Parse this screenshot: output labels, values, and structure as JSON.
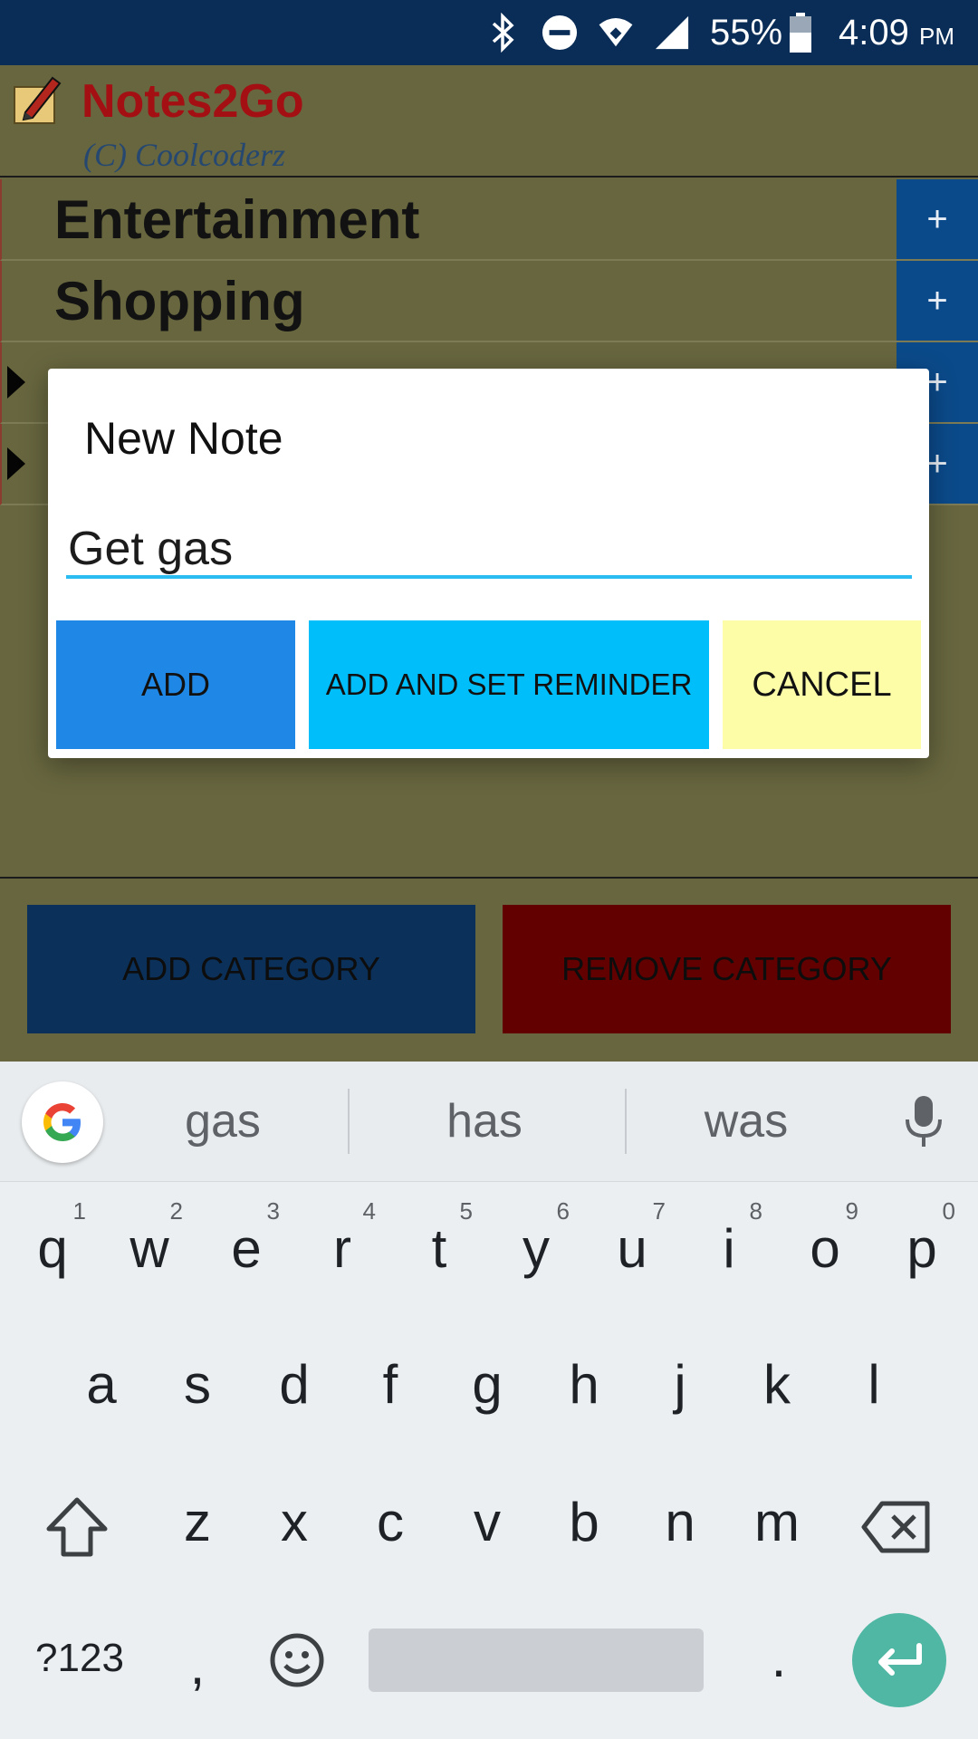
{
  "status_bar": {
    "battery": "55%",
    "time": "4:09",
    "ampm": "PM"
  },
  "app": {
    "title": "Notes2Go",
    "subtitle": "(C) Coolcoderz"
  },
  "categories": [
    {
      "label": "Entertainment",
      "plus": "+"
    },
    {
      "label": "Shopping",
      "plus": "+"
    },
    {
      "label": "",
      "plus": "+"
    },
    {
      "label": "",
      "plus": "+"
    }
  ],
  "buttons": {
    "add_category": "ADD CATEGORY",
    "remove_category": "REMOVE CATEGORY"
  },
  "dialog": {
    "title": "New Note",
    "input_value": "Get gas",
    "add": "ADD",
    "add_and_set_reminder": "ADD AND SET REMINDER",
    "cancel": "CANCEL"
  },
  "keyboard": {
    "suggestions": [
      "gas",
      "has",
      "was"
    ],
    "row1": [
      "q",
      "w",
      "e",
      "r",
      "t",
      "y",
      "u",
      "i",
      "o",
      "p"
    ],
    "row1_hints": [
      "1",
      "2",
      "3",
      "4",
      "5",
      "6",
      "7",
      "8",
      "9",
      "0"
    ],
    "row2": [
      "a",
      "s",
      "d",
      "f",
      "g",
      "h",
      "j",
      "k",
      "l"
    ],
    "row3": [
      "z",
      "x",
      "c",
      "v",
      "b",
      "n",
      "m"
    ],
    "symbols_key": "?123",
    "comma": ",",
    "period": "."
  },
  "colors": {
    "status_bar": "#0a2d57",
    "app_background": "#67663f",
    "title_red": "#a30f12",
    "add_blue": "#1f88e6",
    "reminder_cyan": "#00befa",
    "cancel_yellow": "#fdfda8",
    "add_category": "#0b3059",
    "remove_category": "#620000",
    "enter_key": "#4fb7a4"
  }
}
